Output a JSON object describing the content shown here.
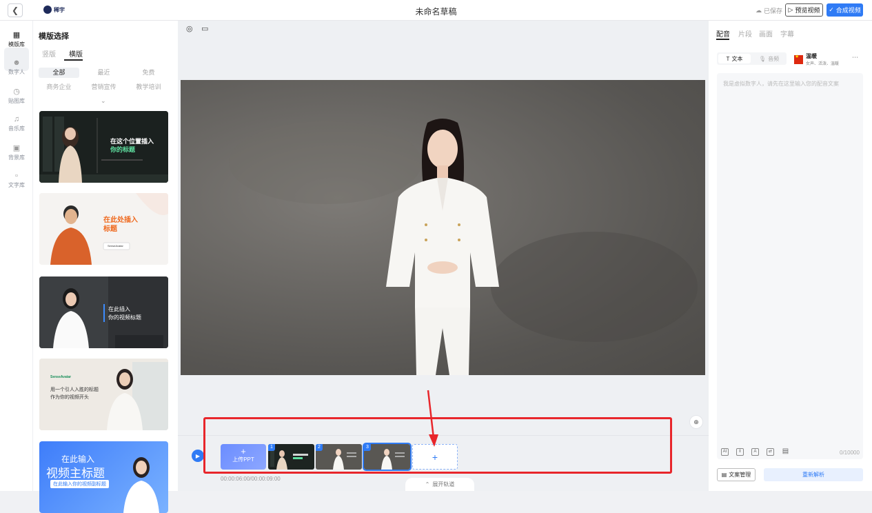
{
  "header": {
    "back_icon": "chevron-left-icon",
    "logo_text": "稀宇",
    "title": "未命名草稿",
    "saved_label": "已保存",
    "preview_label": "预览视频",
    "compose_label": "合成视频",
    "accent": "#2f7bf5"
  },
  "leftnav": {
    "items": [
      {
        "label": "模版库",
        "icon": "layout-icon"
      },
      {
        "label": "数字人",
        "icon": "people-icon"
      },
      {
        "label": "贴图库",
        "icon": "clock-icon"
      },
      {
        "label": "音乐库",
        "icon": "music-icon"
      },
      {
        "label": "背景库",
        "icon": "image-icon"
      },
      {
        "label": "文字库",
        "icon": "text-icon"
      }
    ]
  },
  "templates": {
    "title": "模版选择",
    "tabs": [
      "竖版",
      "横版"
    ],
    "filters": [
      "全部",
      "最近",
      "免费",
      "商务企业",
      "营销宣传",
      "教学培训"
    ],
    "cards": [
      {
        "line1": "在这个位置插入",
        "line2": "你的标题"
      },
      {
        "line1": "在此处插入",
        "line2": "标题",
        "brand": "SenseAvatar"
      },
      {
        "line1": "在此插入",
        "line2": "你的视频标题"
      },
      {
        "brand": "SenseAvatar",
        "line1": "用一个引人入胜的标题",
        "line2": "作为你的视频开头"
      },
      {
        "line1": "在此输入",
        "line2": "视频主标题",
        "line3": "在此输入你的视频副标题"
      }
    ]
  },
  "timeline": {
    "upload_ppt": "上传PPT",
    "slides": [
      "1",
      "2",
      "3"
    ],
    "timecode": "00:00:06:00/00:00:09:00",
    "expand_label": "展开轨道",
    "highlight_color": "#e8262b"
  },
  "right": {
    "tabs": [
      "配音",
      "片段",
      "画面",
      "字幕"
    ],
    "mode_text": "文本",
    "mode_audio": "音频",
    "voice_name": "温暖",
    "voice_desc": "女声、活泼、温暖",
    "placeholder": "我是虚拟数字人，请先在这里输入您的配音文案",
    "char_count": "0/10000",
    "doc_manage": "文案管理",
    "reparse": "重新解析"
  }
}
